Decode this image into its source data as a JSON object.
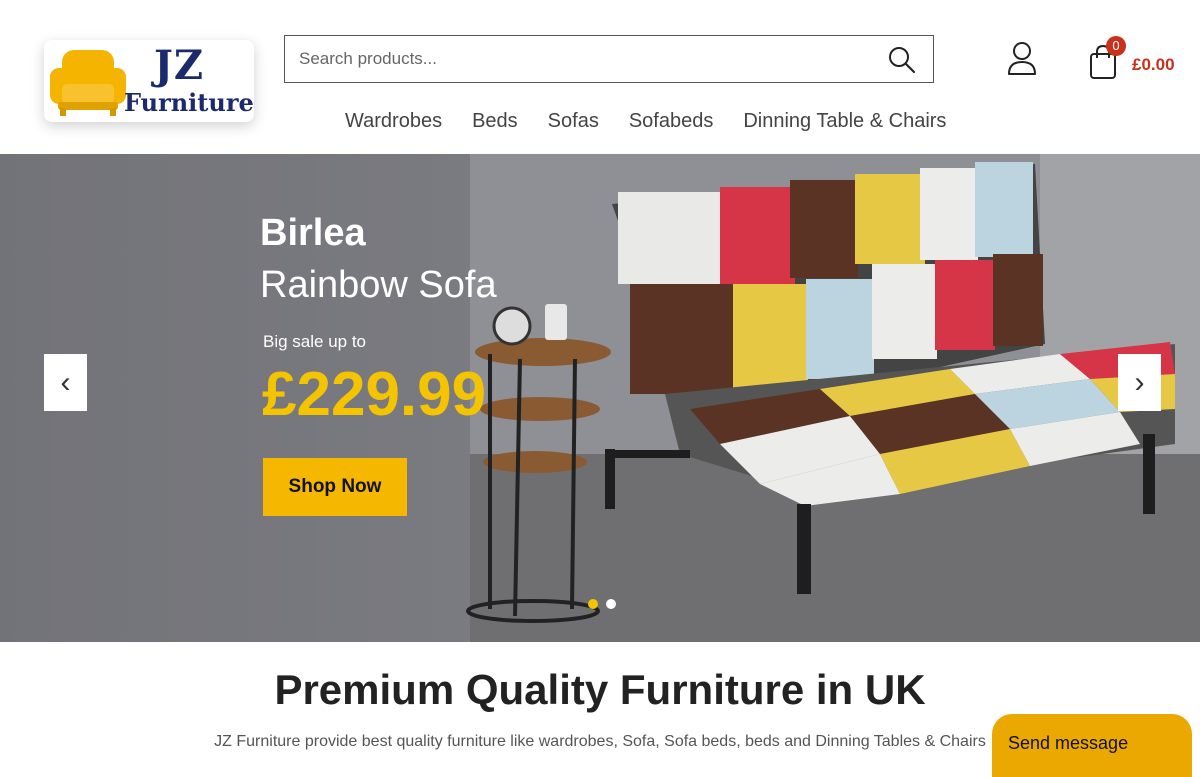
{
  "logo": {
    "line1": "JZ",
    "line2": "Furniture",
    "icon": "armchair-icon"
  },
  "search": {
    "placeholder": "Search products...",
    "value": "",
    "icon": "search-icon"
  },
  "account": {
    "icon": "user-icon"
  },
  "cart": {
    "icon": "shopping-bag-icon",
    "count": "0",
    "total": "£0.00"
  },
  "nav": {
    "items": [
      {
        "label": "Wardrobes"
      },
      {
        "label": "Beds"
      },
      {
        "label": "Sofas"
      },
      {
        "label": "Sofabeds"
      },
      {
        "label": "Dinning Table & Chairs"
      }
    ]
  },
  "hero": {
    "brand": "Birlea",
    "product": "Rainbow Sofa",
    "sale_text": "Big sale up to",
    "price": "£229.99",
    "cta": "Shop Now",
    "prev_icon": "chevron-left-icon",
    "next_icon": "chevron-right-icon",
    "slides": 2,
    "active_slide": 1
  },
  "intro": {
    "title": "Premium Quality Furniture in UK",
    "text": "JZ Furniture provide best quality furniture like wardrobes, Sofa, Sofa beds, beds and Dinning Tables & Chairs"
  },
  "chat": {
    "label": "Send message"
  },
  "colors": {
    "accent": "#f5b700",
    "price": "#f5c400",
    "cart": "#c8321c",
    "brand_navy": "#1a2a6c"
  }
}
